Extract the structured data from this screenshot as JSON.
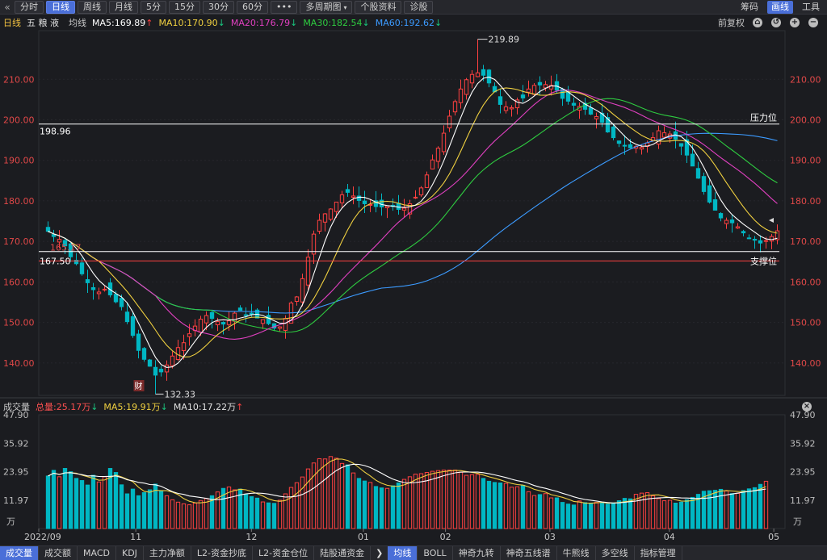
{
  "toolbar": {
    "tabs": [
      {
        "label": "分时",
        "active": false
      },
      {
        "label": "日线",
        "active": true
      },
      {
        "label": "周线",
        "active": false
      },
      {
        "label": "月线",
        "active": false
      },
      {
        "label": "5分",
        "active": false
      },
      {
        "label": "15分",
        "active": false
      },
      {
        "label": "30分",
        "active": false
      },
      {
        "label": "60分",
        "active": false
      },
      {
        "label": "•••",
        "active": false
      },
      {
        "label": "多周期图",
        "active": false
      },
      {
        "label": "个股资料",
        "active": false
      },
      {
        "label": "诊股",
        "active": false
      }
    ],
    "right": [
      {
        "label": "筹码",
        "active": false
      },
      {
        "label": "画线",
        "active": true
      },
      {
        "label": "工具",
        "active": false
      }
    ]
  },
  "info": {
    "period": "日线",
    "stock": "五 粮 液",
    "avg_label": "均线",
    "ma5": "MA5:169.89",
    "ma10": "MA10:170.90",
    "ma20": "MA20:176.79",
    "ma30": "MA30:182.54",
    "ma60": "MA60:192.62",
    "adjust": "前复权"
  },
  "volume_header": {
    "title": "成交量",
    "total": "总量:25.17万",
    "ma5": "MA5:19.91万",
    "ma10": "MA10:17.22万"
  },
  "bottom_tabs": {
    "left": [
      "成交量",
      "成交额",
      "MACD",
      "KDJ",
      "主力净额",
      "L2-资金抄底",
      "L2-资金仓位",
      "陆股通资金"
    ],
    "right": [
      "均线",
      "BOLL",
      "神奇九转",
      "神奇五线谱",
      "牛熊线",
      "多空线",
      "指标管理"
    ]
  },
  "colors": {
    "up": "#ff4040",
    "down": "#00b7c3",
    "ma5": "#ffffff",
    "ma10": "#f0d040",
    "ma20": "#e040c0",
    "ma30": "#2ecc40",
    "ma60": "#3c9bff",
    "pressure_line": "#ffffff",
    "support_line": "#ff4040"
  },
  "chart_data": {
    "type": "candlestick",
    "price_axis": {
      "ticks": [
        "210.00",
        "200.00",
        "190.00",
        "180.00",
        "170.00",
        "160.00",
        "150.00",
        "140.00"
      ],
      "ylim": [
        132,
        222
      ]
    },
    "volume_axis": {
      "ticks": [
        "47.90",
        "35.92",
        "23.95",
        "11.97"
      ],
      "unit": "万",
      "ylim": [
        0,
        47.9
      ]
    },
    "x_labels": [
      "2022/09",
      "11",
      "12",
      "01",
      "02",
      "03",
      "04",
      "05"
    ],
    "annotations": {
      "high": {
        "label": "219.89",
        "value": 219.89
      },
      "low": {
        "label": "132.33",
        "value": 132.33
      },
      "pressure": {
        "label": "压力位",
        "value": 198.96,
        "value_label": "198.96"
      },
      "support": {
        "label": "支撑位",
        "value": 167.5,
        "value_label": "167.50"
      },
      "support2": {
        "value": 165.17,
        "value_label": "165.17"
      },
      "marker": "财"
    },
    "series_close": [
      172.5,
      171.2,
      170.5,
      168.9,
      166.2,
      164.5,
      162.0,
      159.8,
      158.1,
      157.5,
      158.2,
      156.8,
      155.1,
      153.9,
      150.2,
      146.8,
      143.1,
      140.9,
      139.2,
      137.0,
      137.8,
      139.5,
      141.7,
      143.8,
      145.0,
      147.2,
      149.1,
      150.8,
      151.7,
      151.0,
      150.2,
      149.6,
      150.4,
      152.3,
      153.0,
      151.8,
      152.0,
      151.1,
      150.7,
      149.7,
      148.6,
      148.9,
      151.0,
      154.8,
      156.3,
      160.8,
      166.1,
      171.8,
      175.2,
      176.8,
      178.0,
      179.7,
      181.5,
      182.1,
      181.2,
      180.1,
      179.3,
      179.1,
      178.6,
      178.5,
      178.7,
      178.6,
      177.9,
      178.2,
      179.3,
      180.9,
      183.2,
      186.4,
      190.1,
      193.0,
      196.7,
      200.9,
      204.5,
      207.6,
      209.9,
      211.2,
      211.6,
      211.0,
      209.1,
      206.9,
      203.8,
      203.2,
      203.0,
      204.9,
      205.4,
      207.6,
      208.5,
      208.6,
      208.7,
      208.5,
      207.3,
      205.3,
      204.6,
      203.6,
      203.3,
      202.6,
      201.4,
      200.8,
      199.4,
      197.0,
      195.6,
      194.2,
      193.5,
      193.1,
      193.4,
      193.2,
      194.3,
      195.6,
      197.3,
      196.8,
      196.5,
      195.2,
      193.5,
      191.3,
      188.6,
      185.6,
      182.3,
      179.7,
      177.7,
      175.8,
      175.2,
      174.6,
      173.6,
      172.1,
      170.8,
      170.3,
      169.6,
      170.2,
      171.2,
      172.6
    ],
    "series_volume": [
      22.1,
      24.5,
      21.8,
      25.3,
      23.9,
      21.1,
      20.2,
      18.3,
      22.4,
      19.6,
      21.8,
      25.3,
      23.6,
      18.4,
      14.6,
      16.6,
      13.8,
      15.1,
      16.3,
      18.7,
      15.7,
      13.8,
      12.1,
      11.1,
      10.4,
      10.0,
      10.7,
      11.8,
      12.6,
      13.8,
      15.4,
      16.9,
      17.5,
      16.3,
      16.6,
      14.3,
      13.4,
      12.8,
      11.2,
      10.8,
      10.6,
      11.9,
      14.6,
      17.3,
      19.3,
      21.7,
      25.1,
      27.6,
      29.4,
      29.3,
      30.3,
      29.6,
      27.4,
      26.8,
      23.4,
      21.1,
      20.0,
      19.4,
      17.7,
      17.1,
      16.9,
      18.0,
      19.2,
      20.7,
      21.8,
      22.9,
      23.1,
      23.6,
      24.1,
      24.4,
      24.6,
      24.6,
      24.6,
      23.7,
      22.4,
      22.7,
      22.8,
      21.1,
      19.9,
      19.4,
      19.2,
      19.0,
      17.4,
      17.6,
      18.2,
      15.5,
      13.9,
      14.3,
      14.7,
      12.9,
      12.9,
      11.0,
      10.3,
      9.9,
      11.6,
      10.9,
      10.6,
      11.0,
      10.9,
      10.3,
      10.8,
      11.7,
      12.7,
      12.5,
      14.4,
      14.9,
      15.1,
      13.8,
      12.6,
      11.7,
      11.9,
      10.7,
      11.1,
      12.1,
      13.1,
      14.4,
      15.7,
      15.9,
      16.1,
      16.5,
      15.8,
      14.7,
      14.8,
      16.0,
      16.7,
      17.2,
      18.6,
      19.9
    ]
  }
}
